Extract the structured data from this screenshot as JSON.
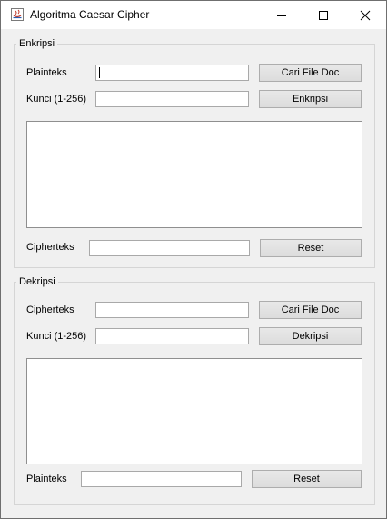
{
  "window": {
    "title": "Algoritma Caesar Cipher"
  },
  "encrypt": {
    "legend": "Enkripsi",
    "plaintext_label": "Plainteks",
    "plaintext_value": "",
    "key_label": "Kunci (1-256)",
    "key_value": "",
    "open_file_button": "Cari File Doc",
    "encrypt_button": "Enkripsi",
    "output_text": "",
    "ciphertext_label": "Cipherteks",
    "ciphertext_value": "",
    "reset_button": "Reset"
  },
  "decrypt": {
    "legend": "Dekripsi",
    "ciphertext_label": "Cipherteks",
    "ciphertext_value": "",
    "key_label": "Kunci (1-256)",
    "key_value": "",
    "open_file_button": "Cari File Doc",
    "decrypt_button": "Dekripsi",
    "output_text": "",
    "plaintext_label": "Plainteks",
    "plaintext_value": "",
    "reset_button": "Reset"
  }
}
